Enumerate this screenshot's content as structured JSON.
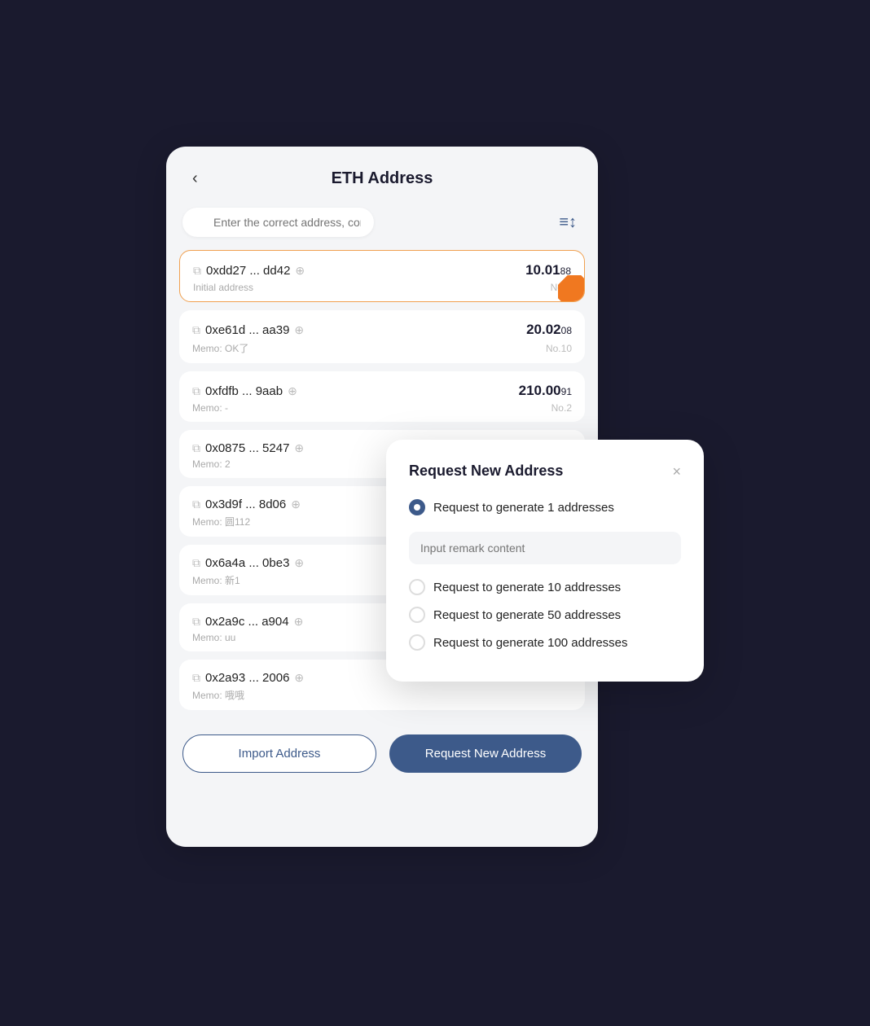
{
  "header": {
    "back_label": "‹",
    "title": "ETH Address"
  },
  "search": {
    "placeholder": "Enter the correct address, comment, serial..."
  },
  "filter_icon": "≡↕",
  "addresses": [
    {
      "address": "0xdd27 ... dd42",
      "memo": "Initial address",
      "amount_main": "10.01",
      "amount_small": "88",
      "no": "No.0",
      "active": true
    },
    {
      "address": "0xe61d ... aa39",
      "memo": "Memo: OK了",
      "amount_main": "20.02",
      "amount_small": "08",
      "no": "No.10",
      "active": false
    },
    {
      "address": "0xfdfb ... 9aab",
      "memo": "Memo: -",
      "amount_main": "210.00",
      "amount_small": "91",
      "no": "No.2",
      "active": false
    },
    {
      "address": "0x0875 ... 5247",
      "memo": "Memo: 2",
      "amount_main": "",
      "amount_small": "",
      "no": "",
      "active": false
    },
    {
      "address": "0x3d9f ... 8d06",
      "memo": "Memo: 圆112",
      "amount_main": "",
      "amount_small": "",
      "no": "",
      "active": false
    },
    {
      "address": "0x6a4a ... 0be3",
      "memo": "Memo: 新1",
      "amount_main": "",
      "amount_small": "",
      "no": "",
      "active": false
    },
    {
      "address": "0x2a9c ... a904",
      "memo": "Memo: uu",
      "amount_main": "",
      "amount_small": "",
      "no": "",
      "active": false
    },
    {
      "address": "0x2a93 ... 2006",
      "memo": "Memo: 哦哦",
      "amount_main": "",
      "amount_small": "",
      "no": "",
      "active": false
    }
  ],
  "buttons": {
    "import": "Import Address",
    "request": "Request New Address"
  },
  "modal": {
    "title": "Request New Address",
    "close_label": "×",
    "options": [
      {
        "label": "Request to generate 1 addresses",
        "checked": true
      },
      {
        "label": "Request to generate 10 addresses",
        "checked": false
      },
      {
        "label": "Request to generate 50 addresses",
        "checked": false
      },
      {
        "label": "Request to generate 100 addresses",
        "checked": false
      }
    ],
    "remark_placeholder": "Input remark content"
  }
}
